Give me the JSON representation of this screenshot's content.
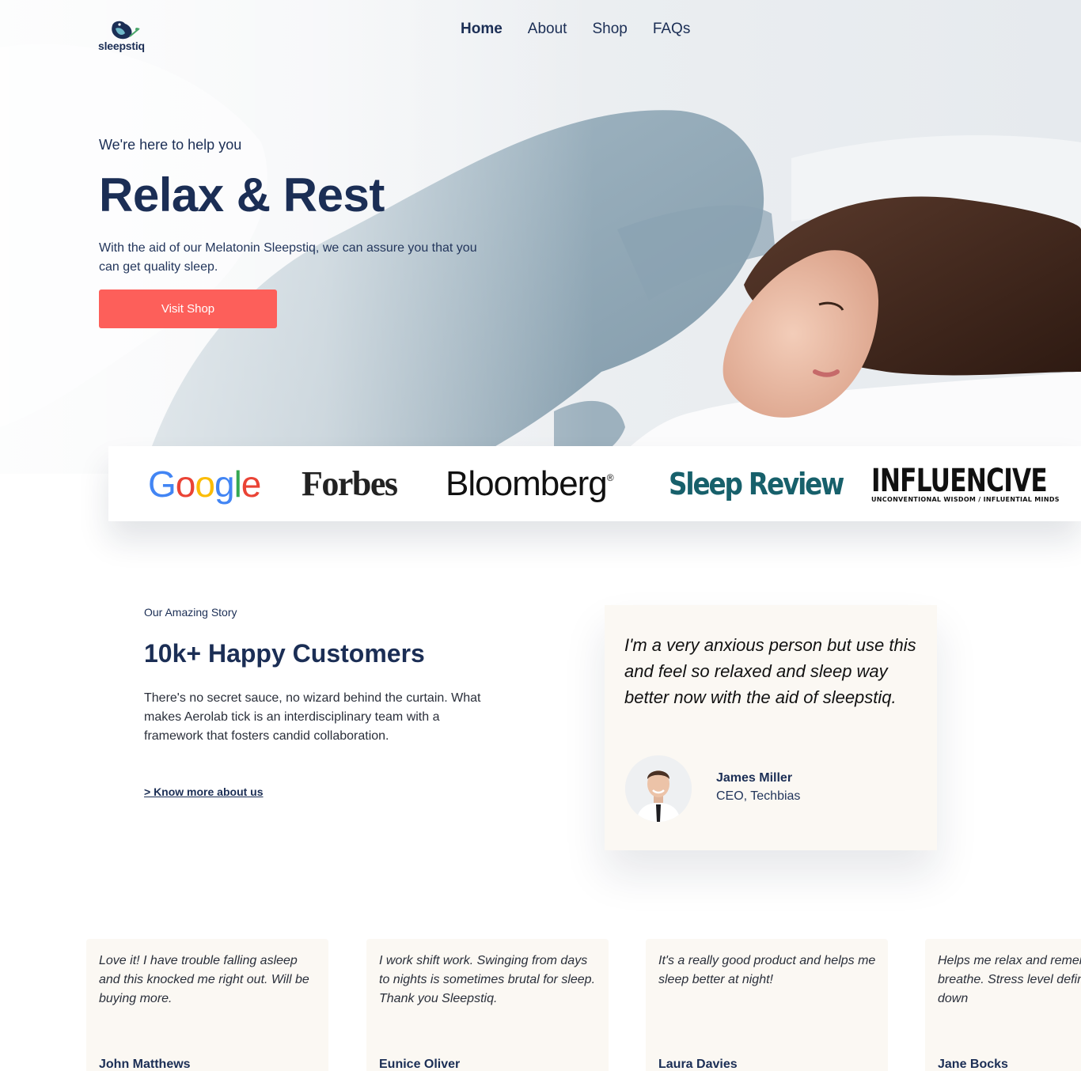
{
  "brand": {
    "name": "sleepstiq"
  },
  "nav": {
    "items": [
      {
        "label": "Home",
        "active": true
      },
      {
        "label": "About",
        "active": false
      },
      {
        "label": "Shop",
        "active": false
      },
      {
        "label": "FAQs",
        "active": false
      }
    ]
  },
  "hero": {
    "eyebrow": "We're here to help you",
    "title": "Relax & Rest",
    "description": "With the aid of our Melatonin Sleepstiq, we can assure you that you can get quality sleep.",
    "cta_label": "Visit Shop",
    "cta_color": "#fd5f5a"
  },
  "press": {
    "logos": [
      {
        "name": "Google"
      },
      {
        "name": "Forbes"
      },
      {
        "name": "Bloomberg",
        "mark": "®"
      },
      {
        "name": "Sleep Review"
      },
      {
        "name": "INFLUENCIVE",
        "tagline": "UNCONVENTIONAL WISDOM / INFLUENTIAL MINDS"
      }
    ]
  },
  "story": {
    "eyebrow": "Our Amazing Story",
    "title": "10k+ Happy Customers",
    "text": "There's no secret sauce, no wizard behind the curtain. What makes Aerolab tick is an interdisciplinary team with a framework that fosters candid collaboration.",
    "link_label": "> Know more about us"
  },
  "featured_testimonial": {
    "quote": "I'm a very anxious person but use this and feel so relaxed and sleep way better now with the aid of sleepstiq.",
    "name": "James Miller",
    "role": "CEO, Techbias"
  },
  "testimonials": [
    {
      "text": "Love it! I have trouble falling asleep and this knocked me right out. Will be buying more.",
      "name": "John Matthews"
    },
    {
      "text": "I work shift work. Swinging from days to nights is sometimes brutal for sleep. Thank you Sleepstiq.",
      "name": "Eunice Oliver"
    },
    {
      "text": "It's a really good product and helps me sleep better at night!",
      "name": "Laura Davies"
    },
    {
      "text": "Helps me relax and remember to breathe. Stress level definitely goes down",
      "name": "Jane Bocks"
    }
  ],
  "colors": {
    "navy": "#1b2e55",
    "coral": "#fd5f5a",
    "cream": "#fbf8f3",
    "teal": "#17606b"
  }
}
